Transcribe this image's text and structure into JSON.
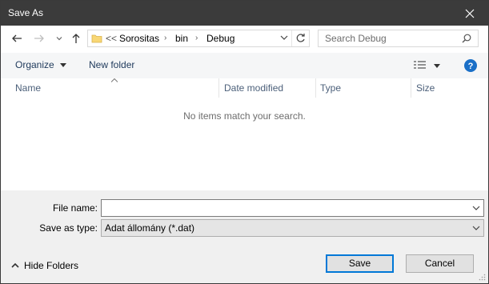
{
  "window": {
    "title": "Save As"
  },
  "icons": {
    "close": "close-icon",
    "back": "arrow-left-icon",
    "forward": "arrow-right-icon",
    "recent": "chevron-down-icon",
    "up": "arrow-up-icon",
    "folder": "folder-icon",
    "refresh": "refresh-icon",
    "search": "search-icon",
    "view": "view-options-icon",
    "help": "help-icon"
  },
  "address": {
    "overflow": "<<",
    "crumbs": [
      "Sorositas",
      "bin",
      "Debug"
    ]
  },
  "search": {
    "placeholder": "Search Debug"
  },
  "toolbar": {
    "organize_label": "Organize",
    "new_folder_label": "New folder"
  },
  "columns": [
    "Name",
    "Date modified",
    "Type",
    "Size"
  ],
  "list": {
    "empty_message": "No items match your search."
  },
  "form": {
    "file_name_label": "File name:",
    "file_name_value": "",
    "save_type_label": "Save as type:",
    "save_type_value": "Adat állomány (*.dat)"
  },
  "footer": {
    "hide_folders_label": "Hide Folders",
    "save_label": "Save",
    "cancel_label": "Cancel"
  },
  "colors": {
    "titlebar": "#3b3b3b",
    "accent": "#0078d7",
    "help": "#1a6fc7"
  }
}
